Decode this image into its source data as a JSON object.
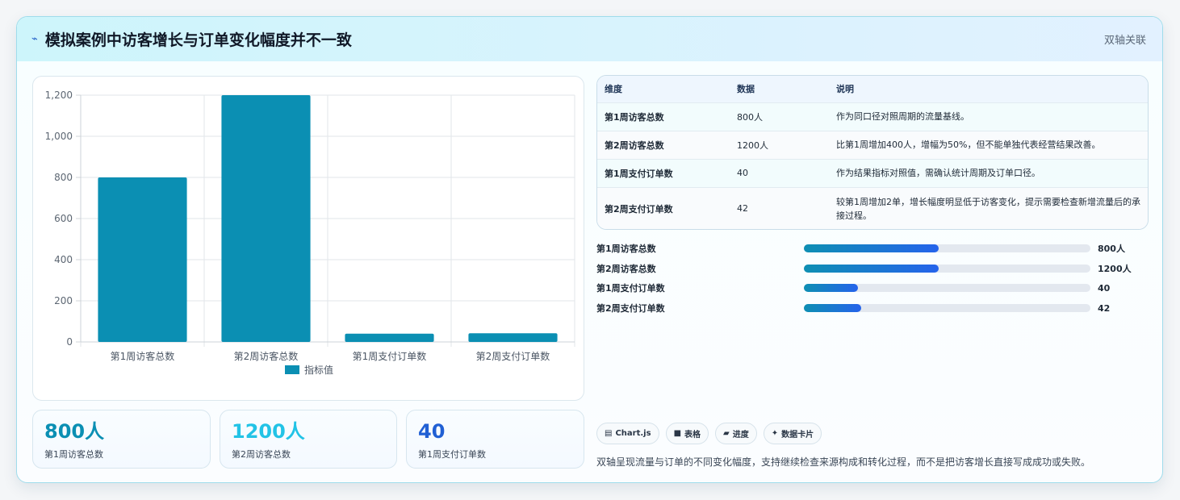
{
  "header": {
    "icon": "pulse-icon",
    "title": "模拟案例中访客增长与订单变化幅度并不一致",
    "tag": "双轴关联"
  },
  "chart_data": {
    "type": "bar",
    "categories": [
      "第1周访客总数",
      "第2周访客总数",
      "第1周支付订单数",
      "第2周支付订单数"
    ],
    "series": [
      {
        "name": "指标值",
        "values": [
          800,
          1200,
          40,
          42
        ]
      }
    ],
    "ylim": [
      0,
      1200
    ],
    "yticks": [
      "0",
      "200",
      "400",
      "600",
      "800",
      "1,000",
      "1,200"
    ],
    "grid": true,
    "legend": "bottom",
    "color": "#0b8fb3"
  },
  "stats": [
    {
      "value": "800人",
      "label": "第1周访客总数",
      "color": "#0b8fb3"
    },
    {
      "value": "1200人",
      "label": "第2周访客总数",
      "color": "#22c3e6"
    },
    {
      "value": "40",
      "label": "第1周支付订单数",
      "color": "#2160d4"
    }
  ],
  "table": {
    "headers": [
      "维度",
      "数据",
      "说明"
    ],
    "rows": [
      [
        "第1周访客总数",
        "800人",
        "作为同口径对照周期的流量基线。"
      ],
      [
        "第2周访客总数",
        "1200人",
        "比第1周增加400人，增幅为50%，但不能单独代表经营结果改善。"
      ],
      [
        "第1周支付订单数",
        "40",
        "作为结果指标对照值，需确认统计周期及订单口径。"
      ],
      [
        "第2周支付订单数",
        "42",
        "较第1周增加2单，增长幅度明显低于访客变化，提示需要检查新增流量后的承接过程。"
      ]
    ]
  },
  "progress": [
    {
      "label": "第1周访客总数",
      "value": "800人",
      "fraction": 0.47
    },
    {
      "label": "第2周访客总数",
      "value": "1200人",
      "fraction": 0.47
    },
    {
      "label": "第1周支付订单数",
      "value": "40",
      "fraction": 0.19
    },
    {
      "label": "第2周支付订单数",
      "value": "42",
      "fraction": 0.2
    }
  ],
  "chips": [
    {
      "icon": "chart-icon",
      "glyph": "▤",
      "label": "Chart.js"
    },
    {
      "icon": "table-icon",
      "glyph": "■",
      "label": "表格"
    },
    {
      "icon": "progress-icon",
      "glyph": "▰",
      "label": "进度"
    },
    {
      "icon": "sparkle-icon",
      "glyph": "✦",
      "label": "数据卡片"
    }
  ],
  "footer_note": "双轴呈现流量与订单的不同变化幅度，支持继续检查来源构成和转化过程，而不是把访客增长直接写成成功或失败。"
}
